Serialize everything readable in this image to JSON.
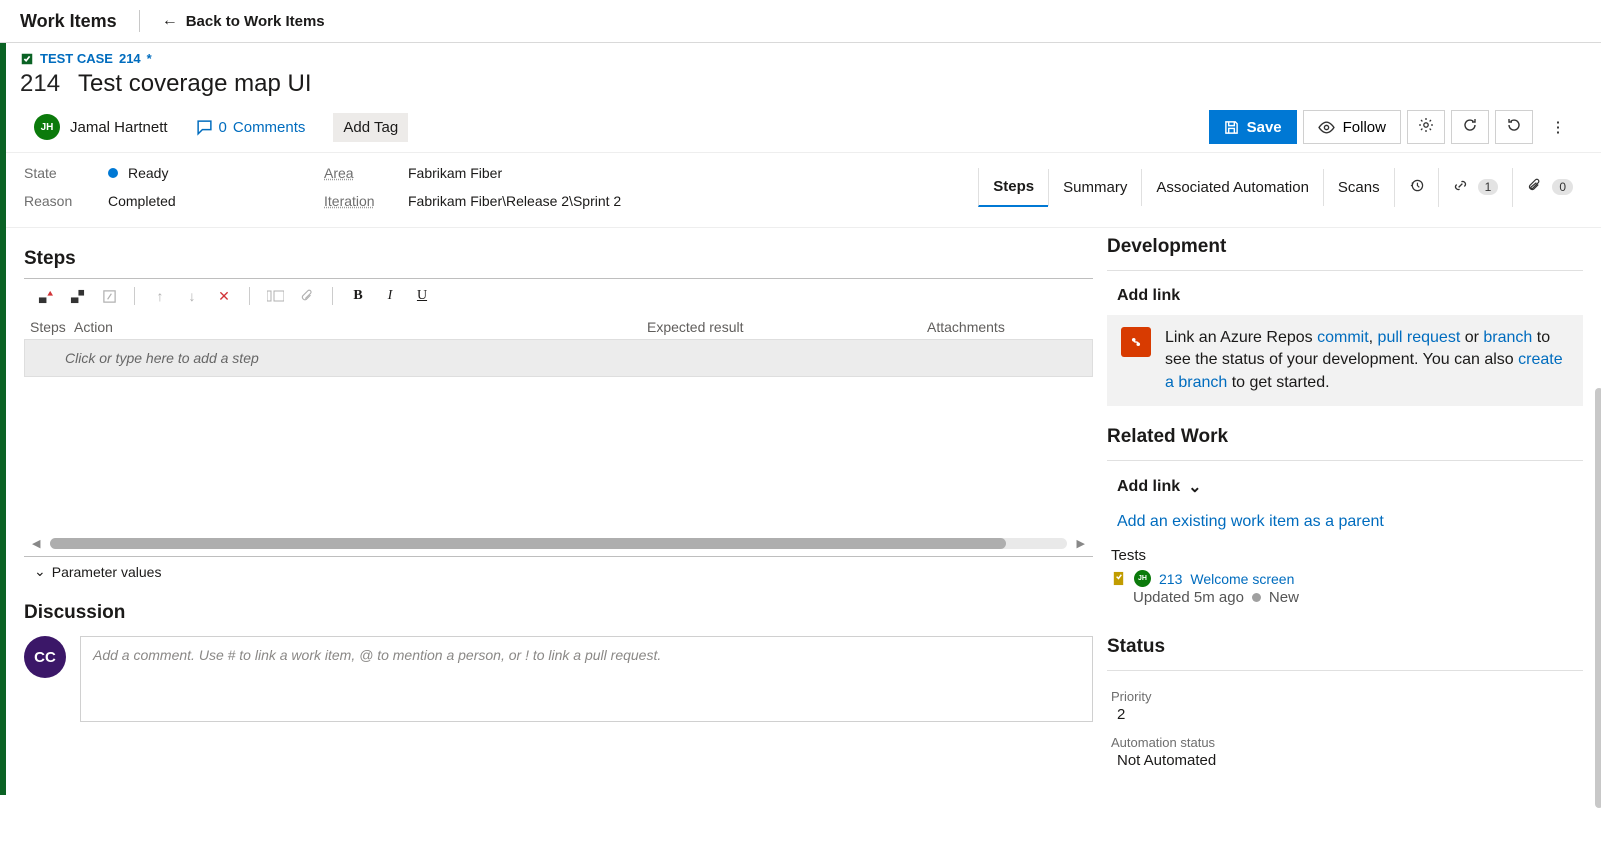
{
  "header": {
    "page_title": "Work Items",
    "back_label": "Back to Work Items"
  },
  "breadcrumb": {
    "type_label": "TEST CASE",
    "id": "214",
    "dirty_marker": "*"
  },
  "work_item": {
    "id": "214",
    "title": "Test coverage map UI",
    "assignee": {
      "initials": "JH",
      "name": "Jamal Hartnett"
    },
    "comments_count": "0",
    "comments_label": "Comments",
    "add_tag_label": "Add Tag"
  },
  "actions": {
    "save_label": "Save",
    "follow_label": "Follow"
  },
  "fields": {
    "state_label": "State",
    "state_value": "Ready",
    "reason_label": "Reason",
    "reason_value": "Completed",
    "area_label": "Area",
    "area_value": "Fabrikam Fiber",
    "iteration_label": "Iteration",
    "iteration_value": "Fabrikam Fiber\\Release 2\\Sprint 2"
  },
  "tabs": {
    "steps": "Steps",
    "summary": "Summary",
    "automation": "Associated Automation",
    "scans": "Scans",
    "links_count": "1",
    "attach_count": "0"
  },
  "steps": {
    "heading": "Steps",
    "col_steps": "Steps",
    "col_action": "Action",
    "col_expected": "Expected result",
    "col_attach": "Attachments",
    "placeholder": "Click or type here to add a step",
    "param_values": "Parameter values"
  },
  "discussion": {
    "heading": "Discussion",
    "user_initials": "CC",
    "placeholder": "Add a comment. Use # to link a work item, @ to mention a person, or ! to link a pull request."
  },
  "dev": {
    "heading": "Development",
    "add_link_label": "Add link",
    "text_pre": "Link an Azure Repos ",
    "commit": "commit",
    "sep1": ", ",
    "pull_request": "pull request",
    "sep2": " or ",
    "branch": "branch",
    "text_mid": " to see the status of your development. You can also ",
    "create_branch": "create a branch",
    "text_post": " to get started."
  },
  "related": {
    "heading": "Related Work",
    "add_link_label": "Add link",
    "add_parent": "Add an existing work item as a parent",
    "tests_label": "Tests",
    "test_item": {
      "assignee_initials": "JH",
      "id": "213",
      "title": "Welcome screen",
      "updated": "Updated 5m ago",
      "state": "New"
    }
  },
  "status": {
    "heading": "Status",
    "priority_label": "Priority",
    "priority_value": "2",
    "auto_label": "Automation status",
    "auto_value": "Not Automated"
  }
}
